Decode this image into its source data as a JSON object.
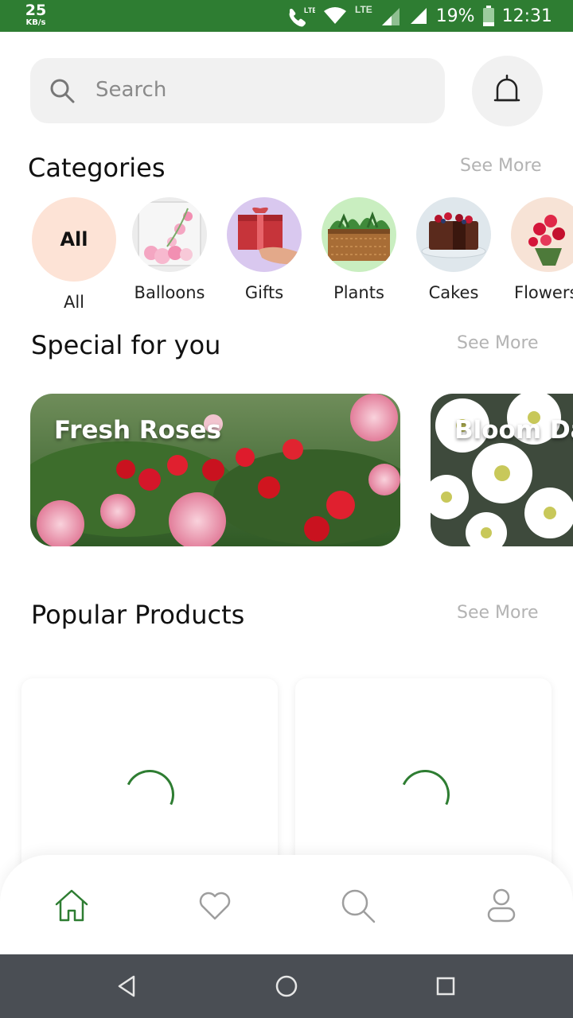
{
  "status_bar": {
    "net_speed_value": "25",
    "net_speed_unit": "KB/s",
    "battery": "19%",
    "time": "12:31",
    "icons": [
      "call-lte-icon",
      "wifi-icon",
      "lte-signal-icon",
      "signal-icon",
      "battery-icon"
    ]
  },
  "search": {
    "placeholder": "Search",
    "icon": "search-icon"
  },
  "notification": {
    "icon": "bell-icon"
  },
  "categories": {
    "title": "Categories",
    "see_more": "See More",
    "items": [
      {
        "label": "All",
        "inner": "All",
        "icon": "all-badge"
      },
      {
        "label": "Balloons",
        "icon": "balloons-image"
      },
      {
        "label": "Gifts",
        "icon": "gift-image"
      },
      {
        "label": "Plants",
        "icon": "plants-image"
      },
      {
        "label": "Cakes",
        "icon": "cake-image"
      },
      {
        "label": "Flowers",
        "icon": "flowers-image"
      }
    ]
  },
  "special": {
    "title": "Special for you",
    "see_more": "See More",
    "cards": [
      {
        "title": "Fresh Roses"
      },
      {
        "title": "Bloom Daisies"
      }
    ]
  },
  "popular": {
    "title": "Popular Products",
    "see_more": "See More"
  },
  "bottom_nav": {
    "items": [
      {
        "icon": "home-icon",
        "active": true
      },
      {
        "icon": "heart-icon",
        "active": false
      },
      {
        "icon": "search-icon",
        "active": false
      },
      {
        "icon": "profile-icon",
        "active": false
      }
    ]
  },
  "colors": {
    "brand_green": "#2e7d32",
    "all_chip": "#fde3d6",
    "muted_text": "#b3b3b3",
    "inactive_icon": "#9e9e9e"
  }
}
